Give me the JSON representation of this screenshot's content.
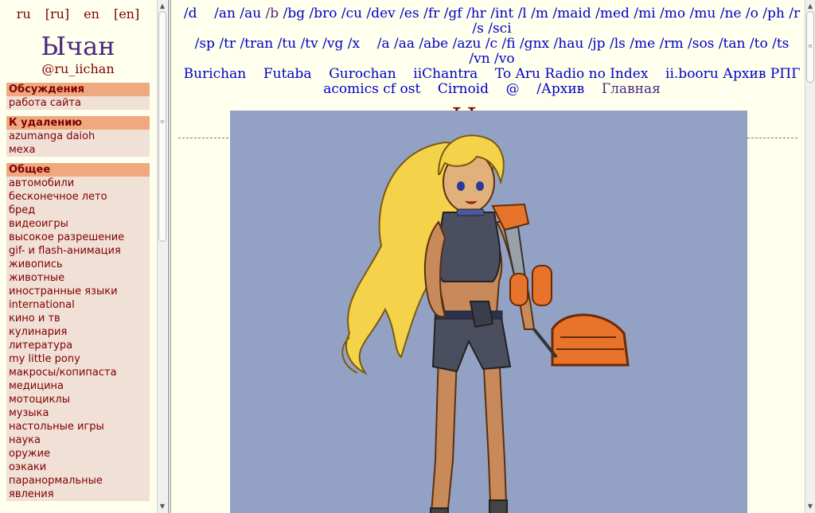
{
  "lang": [
    "ru",
    "[ru]",
    "en",
    "[en]"
  ],
  "site": {
    "title": "Ычан",
    "subtitle": "@ru_iichan"
  },
  "sections": [
    {
      "heading": "Обсуждения",
      "items": [
        "работа сайта"
      ]
    },
    {
      "heading": "К удалению",
      "items": [
        "azumanga daioh",
        "меха"
      ]
    },
    {
      "heading": "Общее",
      "items": [
        "автомобили",
        "бесконечное лето",
        "бред",
        "видеоигры",
        "высокое разрешение",
        "gif- и flash-анимация",
        "живопись",
        "животные",
        "иностранные языки",
        "international",
        "кино и тв",
        "кулинария",
        "литература",
        "my little pony",
        "макросы/копипаста",
        "медицина",
        "мотоциклы",
        "музыка",
        "настольные игры",
        "наука",
        "оружие",
        "оэкаки",
        "паранормальные",
        "явления"
      ]
    }
  ],
  "boards": {
    "line1": [
      "/d",
      "/an",
      "/au",
      "/b",
      "/bg",
      "/bro",
      "/cu",
      "/dev",
      "/es",
      "/fr",
      "/gf",
      "/hr",
      "/int",
      "/l",
      "/m",
      "/maid",
      "/med",
      "/mi",
      "/mo",
      "/mu",
      "/ne",
      "/o",
      "/ph",
      "/r",
      "/s",
      "/sci"
    ],
    "line2": [
      "/sp",
      "/tr",
      "/tran",
      "/tu",
      "/tv",
      "/vg",
      "/x",
      "/a",
      "/aa",
      "/abe",
      "/azu",
      "/c",
      "/fi",
      "/gnx",
      "/hau",
      "/jp",
      "/ls",
      "/me",
      "/rm",
      "/sos",
      "/tan",
      "/to",
      "/ts",
      "/vn",
      "/vo"
    ],
    "line3": [
      "Burichan",
      "Futaba",
      "Gurochan",
      "iiChantra",
      "To Aru Radio no Index",
      "ii.booru",
      "Архив РПГ"
    ],
    "line4": [
      "acomics cf ost",
      "Cirnoid",
      "@",
      "/Архив",
      "Главная"
    ]
  },
  "main_title": "Ычан",
  "banner": {
    "description": "blonde-girl-with-orange-arm-cannon",
    "bg_color": "#93a2c4"
  },
  "colors": {
    "page_bg": "#ffffee",
    "link": "#0000c8",
    "visited": "#4b2a7e",
    "maroon": "#800000",
    "section_head": "#f0a880",
    "section_body": "#f0e0d6"
  }
}
